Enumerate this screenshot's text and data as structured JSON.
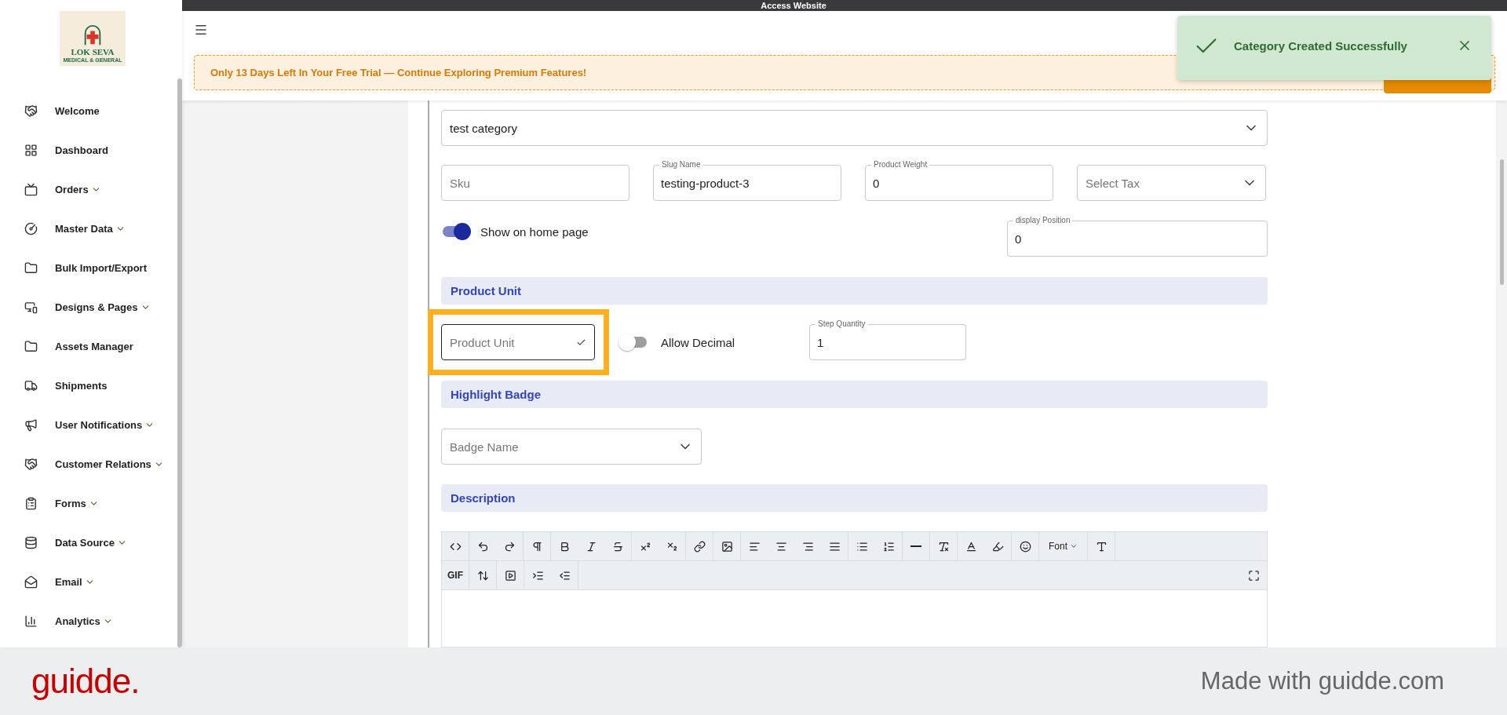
{
  "top_bar": {
    "title": "Access Website"
  },
  "sidebar": {
    "logo": {
      "name": "LOK SEVA",
      "tagline": "MEDICAL & GENERAL"
    },
    "items": [
      {
        "label": "Welcome",
        "expandable": false
      },
      {
        "label": "Dashboard",
        "expandable": false
      },
      {
        "label": "Orders",
        "expandable": true
      },
      {
        "label": "Master Data",
        "expandable": true
      },
      {
        "label": "Bulk Import/Export",
        "expandable": false
      },
      {
        "label": "Designs & Pages",
        "expandable": true
      },
      {
        "label": "Assets Manager",
        "expandable": false
      },
      {
        "label": "Shipments",
        "expandable": false
      },
      {
        "label": "User Notifications",
        "expandable": true
      },
      {
        "label": "Customer Relations",
        "expandable": true
      },
      {
        "label": "Forms",
        "expandable": true
      },
      {
        "label": "Data Source",
        "expandable": true
      },
      {
        "label": "Email",
        "expandable": true
      },
      {
        "label": "Analytics",
        "expandable": true
      }
    ]
  },
  "trial_banner": "Only 13 Days Left In Your Free Trial — Continue Exploring Premium Features!",
  "toast": {
    "message": "Category Created Successfully"
  },
  "form": {
    "category": {
      "value": "test category"
    },
    "sku": {
      "placeholder": "Sku"
    },
    "slug": {
      "label": "Slug Name",
      "value": "testing-product-3"
    },
    "weight": {
      "label": "Product Weight",
      "value": "0"
    },
    "tax": {
      "placeholder": "Select Tax"
    },
    "show_on_home": {
      "label": "Show on home page",
      "on": true
    },
    "display_position": {
      "label": "display Position",
      "value": "0"
    },
    "product_unit_section": {
      "title": "Product Unit",
      "unit": {
        "placeholder": "Product Unit",
        "focused": true,
        "highlighted": true
      },
      "allow_decimal": {
        "label": "Allow Decimal",
        "on": false
      },
      "step_quantity": {
        "label": "Step Quantity",
        "value": "1"
      }
    },
    "highlight_badge_section": {
      "title": "Highlight Badge",
      "badge": {
        "placeholder": "Badge Name"
      }
    },
    "description_section": {
      "title": "Description",
      "toolbar": {
        "font_menu": "Font",
        "gif_button": "GIF"
      }
    }
  },
  "footer": {
    "brand": "guidde.",
    "tagline": "Made with guidde.com"
  }
}
